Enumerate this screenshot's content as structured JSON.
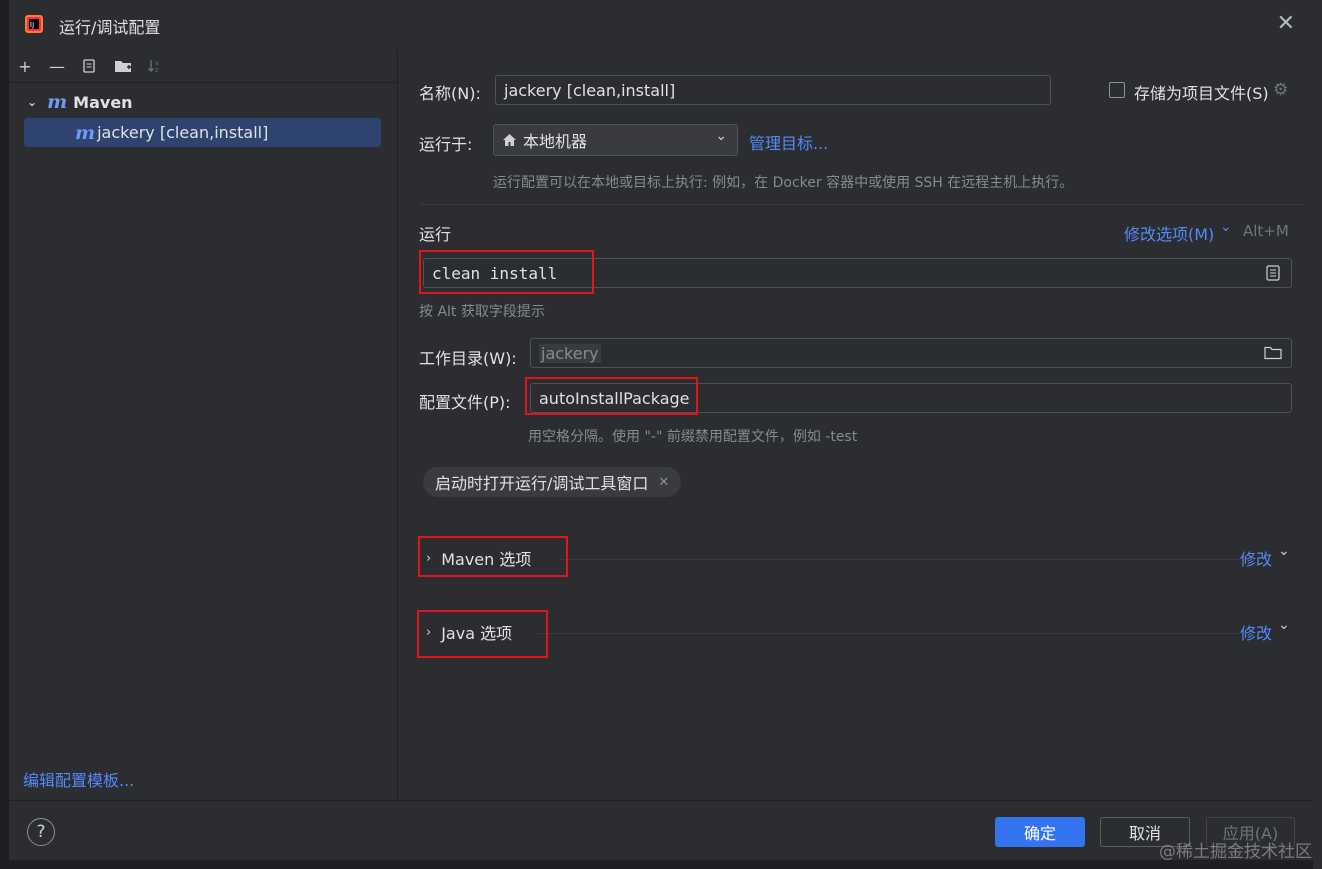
{
  "window": {
    "title": "运行/调试配置"
  },
  "toolbar": {
    "add": "+",
    "remove": "—"
  },
  "tree": {
    "parent": {
      "icon": "m",
      "label": "Maven"
    },
    "selected": {
      "icon": "m",
      "label": "jackery [clean,install]"
    }
  },
  "left_footer": {
    "edit_templates": "编辑配置模板..."
  },
  "form": {
    "name_label": "名称(N):",
    "name_value": "jackery [clean,install]",
    "store_label": "存储为项目文件(S)",
    "run_on_label": "运行于:",
    "run_on_value": "本地机器",
    "manage_targets": "管理目标...",
    "run_on_hint": "运行配置可以在本地或目标上执行: 例如，在 Docker 容器中或使用 SSH 在远程主机上执行。",
    "run_section": "运行",
    "modify_options": "修改选项(M)",
    "modify_shortcut": "Alt+M",
    "command_value": "clean install",
    "command_hint": "按 Alt 获取字段提示",
    "workdir_label": "工作目录(W):",
    "workdir_value": "jackery",
    "profiles_label": "配置文件(P):",
    "profiles_value": "autoInstallPackage",
    "profiles_hint": "用空格分隔。使用 \"-\" 前缀禁用配置文件，例如 -test",
    "chip_label": "启动时打开运行/调试工具窗口",
    "maven_section": "Maven 选项",
    "java_section": "Java 选项",
    "modify_label": "修改"
  },
  "buttons": {
    "ok": "确定",
    "cancel": "取消",
    "apply": "应用(A)",
    "help": "?"
  },
  "watermark": "@稀土掘金技术社区",
  "colors": {
    "accent": "#3574f0",
    "link": "#548af7",
    "highlight_box": "#e0161b",
    "selection": "#2e436e"
  }
}
